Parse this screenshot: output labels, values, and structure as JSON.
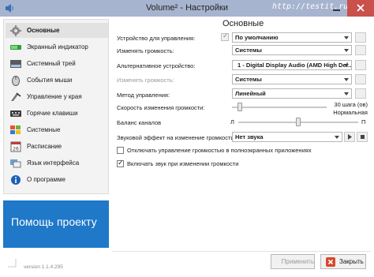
{
  "window": {
    "title": "Volume² - Настройки",
    "watermark": "http://testit.ru",
    "min_icon": "minimize-icon",
    "close_icon": "close-icon"
  },
  "sidebar": {
    "items": [
      {
        "label": "Основные",
        "icon": "general-settings-icon",
        "active": true
      },
      {
        "label": "Экранный индикатор",
        "icon": "osd-indicator-icon"
      },
      {
        "label": "Системный трей",
        "icon": "system-tray-icon"
      },
      {
        "label": "События мыши",
        "icon": "mouse-events-icon"
      },
      {
        "label": "Управление у края",
        "icon": "edge-control-icon"
      },
      {
        "label": "Горячие клавиши",
        "icon": "hotkeys-icon"
      },
      {
        "label": "Системные",
        "icon": "system-icon"
      },
      {
        "label": "Расписание",
        "icon": "calendar-icon"
      },
      {
        "label": "Язык интерфейса",
        "icon": "language-icon"
      },
      {
        "label": "О программе",
        "icon": "info-icon"
      }
    ]
  },
  "promo": {
    "label": "Помощь проекту"
  },
  "version": "version 1.1.4.295",
  "main": {
    "title": "Основные",
    "device_label": "Устройство для управления:",
    "device_value": "По умолчанию",
    "change_volume_label": "Изменять громкость:",
    "change_volume_value": "Системы",
    "alt_device_label": "Альтернативное устройство:",
    "alt_device_value": "1 - Digital Display Audio (AMD High Def...",
    "alt_change_volume_label": "Изменять громкость:",
    "alt_change_volume_value": "Системы",
    "method_label": "Метод управления:",
    "method_value": "Линейный",
    "rate_label": "Скорость изменения громкости:",
    "rate_value_line1": "30 шага (ов)",
    "rate_value_line2": "Нормальная",
    "balance_label": "Баланс каналов",
    "balance_left": "Л",
    "balance_right": "П",
    "sound_label": "Звуковой эффект на изменение громкости:",
    "sound_value": "Нет звука",
    "check_fullscreen_label": "Отключать управление громкостью в полноэкранных приложениях",
    "check_fullscreen": false,
    "check_unmute_label": "Включать звук при изменении громкости",
    "check_unmute": true,
    "rate_level": 0.08,
    "balance_level": 0.5
  },
  "buttons": {
    "apply": "Применить",
    "close": "Закрыть"
  },
  "colors": {
    "titlebar": "#a7b4cf",
    "promo": "#1f78c8",
    "close": "#c9504b"
  }
}
